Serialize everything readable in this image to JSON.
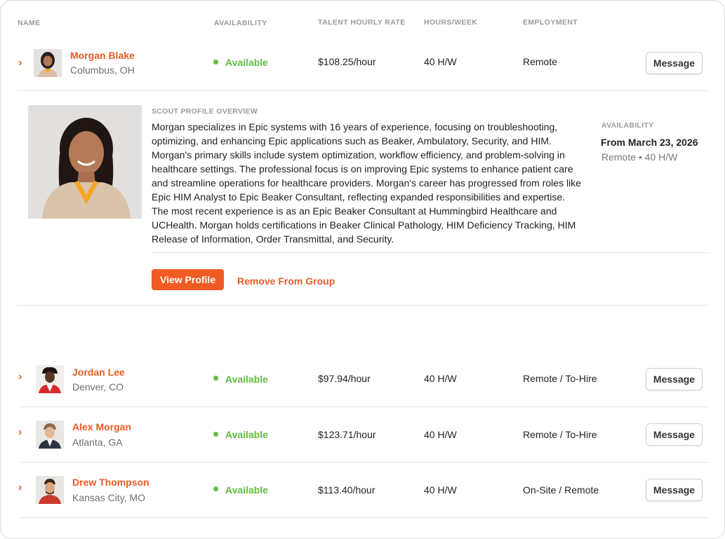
{
  "headers": {
    "name": "NAME",
    "availability": "AVAILABILITY",
    "rate": "TALENT HOURLY RATE",
    "hours": "HOURS/WEEK",
    "employment": "EMPLOYMENT"
  },
  "accent_color": "#F05A23",
  "available_color": "#5FBF3F",
  "rows": [
    {
      "name": "Morgan Blake",
      "location": "Columbus, OH",
      "availability": "Available",
      "rate": "$108.25/hour",
      "hours": "40 H/W",
      "employment": "Remote",
      "message": "Message",
      "expanded": true
    },
    {
      "name": "Jordan Lee",
      "location": "Denver, CO",
      "availability": "Available",
      "rate": "$97.94/hour",
      "hours": "40 H/W",
      "employment": "Remote / To-Hire",
      "message": "Message",
      "expanded": false
    },
    {
      "name": "Alex Morgan",
      "location": "Atlanta, GA",
      "availability": "Available",
      "rate": "$123.71/hour",
      "hours": "40 H/W",
      "employment": "Remote / To-Hire",
      "message": "Message",
      "expanded": false
    },
    {
      "name": "Drew Thompson",
      "location": "Kansas City, MO",
      "availability": "Available",
      "rate": "$113.40/hour",
      "hours": "40 H/W",
      "employment": "On-Site / Remote",
      "message": "Message",
      "expanded": false
    }
  ],
  "expanded_panel": {
    "section_label": "SCOUT PROFILE OVERVIEW",
    "overview": "Morgan specializes in Epic systems with 16 years of experience, focusing on troubleshooting, optimizing, and enhancing Epic applications such as Beaker, Ambulatory, Security, and HIM. Morgan's primary skills include system optimization, workflow efficiency, and problem-solving in healthcare settings. The professional focus is on improving Epic systems to enhance patient care and streamline operations for healthcare providers. Morgan's career has progressed from roles like Epic HIM Analyst to Epic Beaker Consultant, reflecting expanded responsibilities and expertise. The most recent experience is as an Epic Beaker Consultant at Hummingbird Healthcare and UCHealth. Morgan holds certifications in Beaker Clinical Pathology, HIM Deficiency Tracking, HIM Release of Information, Order Transmittal, and Security.",
    "view_profile": "View Profile",
    "remove_from_group": "Remove From Group",
    "availability_label": "AVAILABILITY",
    "availability_date": "From March 23, 2026",
    "availability_detail": "Remote • 40 H/W"
  },
  "icons": {
    "expand": "chevron-right-icon",
    "status": "status-dot-icon"
  }
}
